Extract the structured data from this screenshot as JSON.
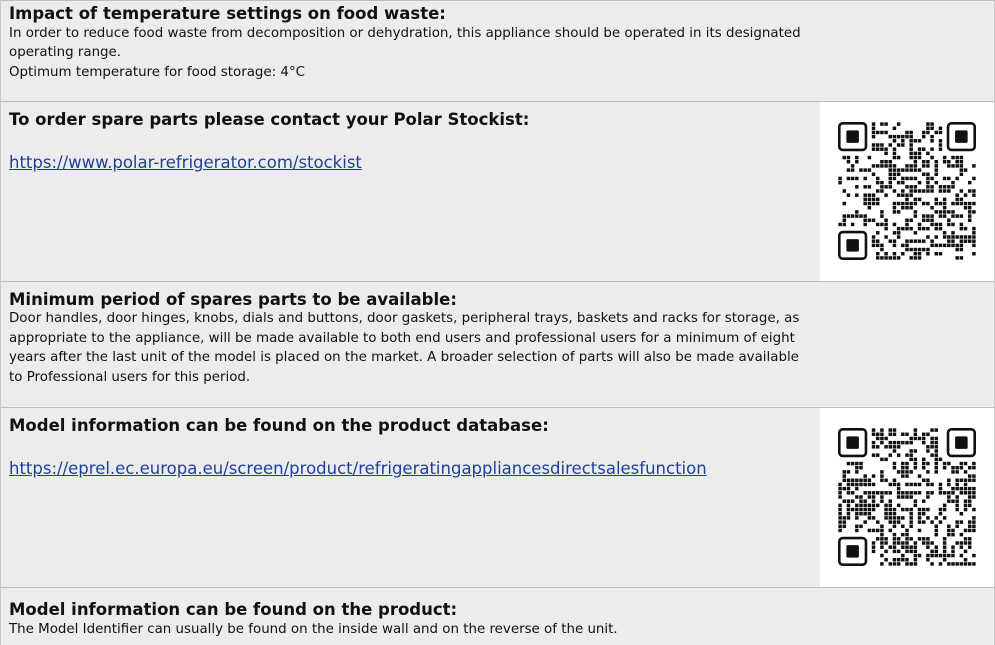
{
  "sections": {
    "temperature": {
      "heading": "Impact of temperature settings on food waste:",
      "line1": "In order to reduce food waste from decomposition or dehydration, this appliance should be operated in its designated",
      "line2": "operating range.",
      "line3": "Optimum temperature for food storage: 4°C"
    },
    "spares_order": {
      "heading": "To order spare parts please contact your Polar Stockist:",
      "link": "https://www.polar-refrigerator.com/stockist",
      "qr_icon": "qr-code-icon"
    },
    "spares_period": {
      "heading": "Minimum period of spares parts to be available:",
      "line1": "Door handles, door hinges, knobs, dials and buttons, door gaskets, peripheral trays, baskets and racks for storage, as",
      "line2": "appropriate to the appliance, will be made available to both end users and professional users for a minimum of eight",
      "line3": "years after the last unit of the model is placed on the market. A broader selection of parts will also be made available",
      "line4": "to Professional users for this period."
    },
    "database": {
      "heading": "Model information can be found on the product database:",
      "link": "https://eprel.ec.europa.eu/screen/product/refrigeratingappliancesdirectsalesfunction",
      "qr_icon": "qr-code-icon"
    },
    "product": {
      "heading": "Model information can be found on the product:",
      "line1": "The Model Identifier can usually be found on the inside wall and on the reverse of the unit."
    }
  },
  "colors": {
    "row_bg": "#ececec",
    "link": "#1f3f9a",
    "border": "#bdbdbd"
  }
}
